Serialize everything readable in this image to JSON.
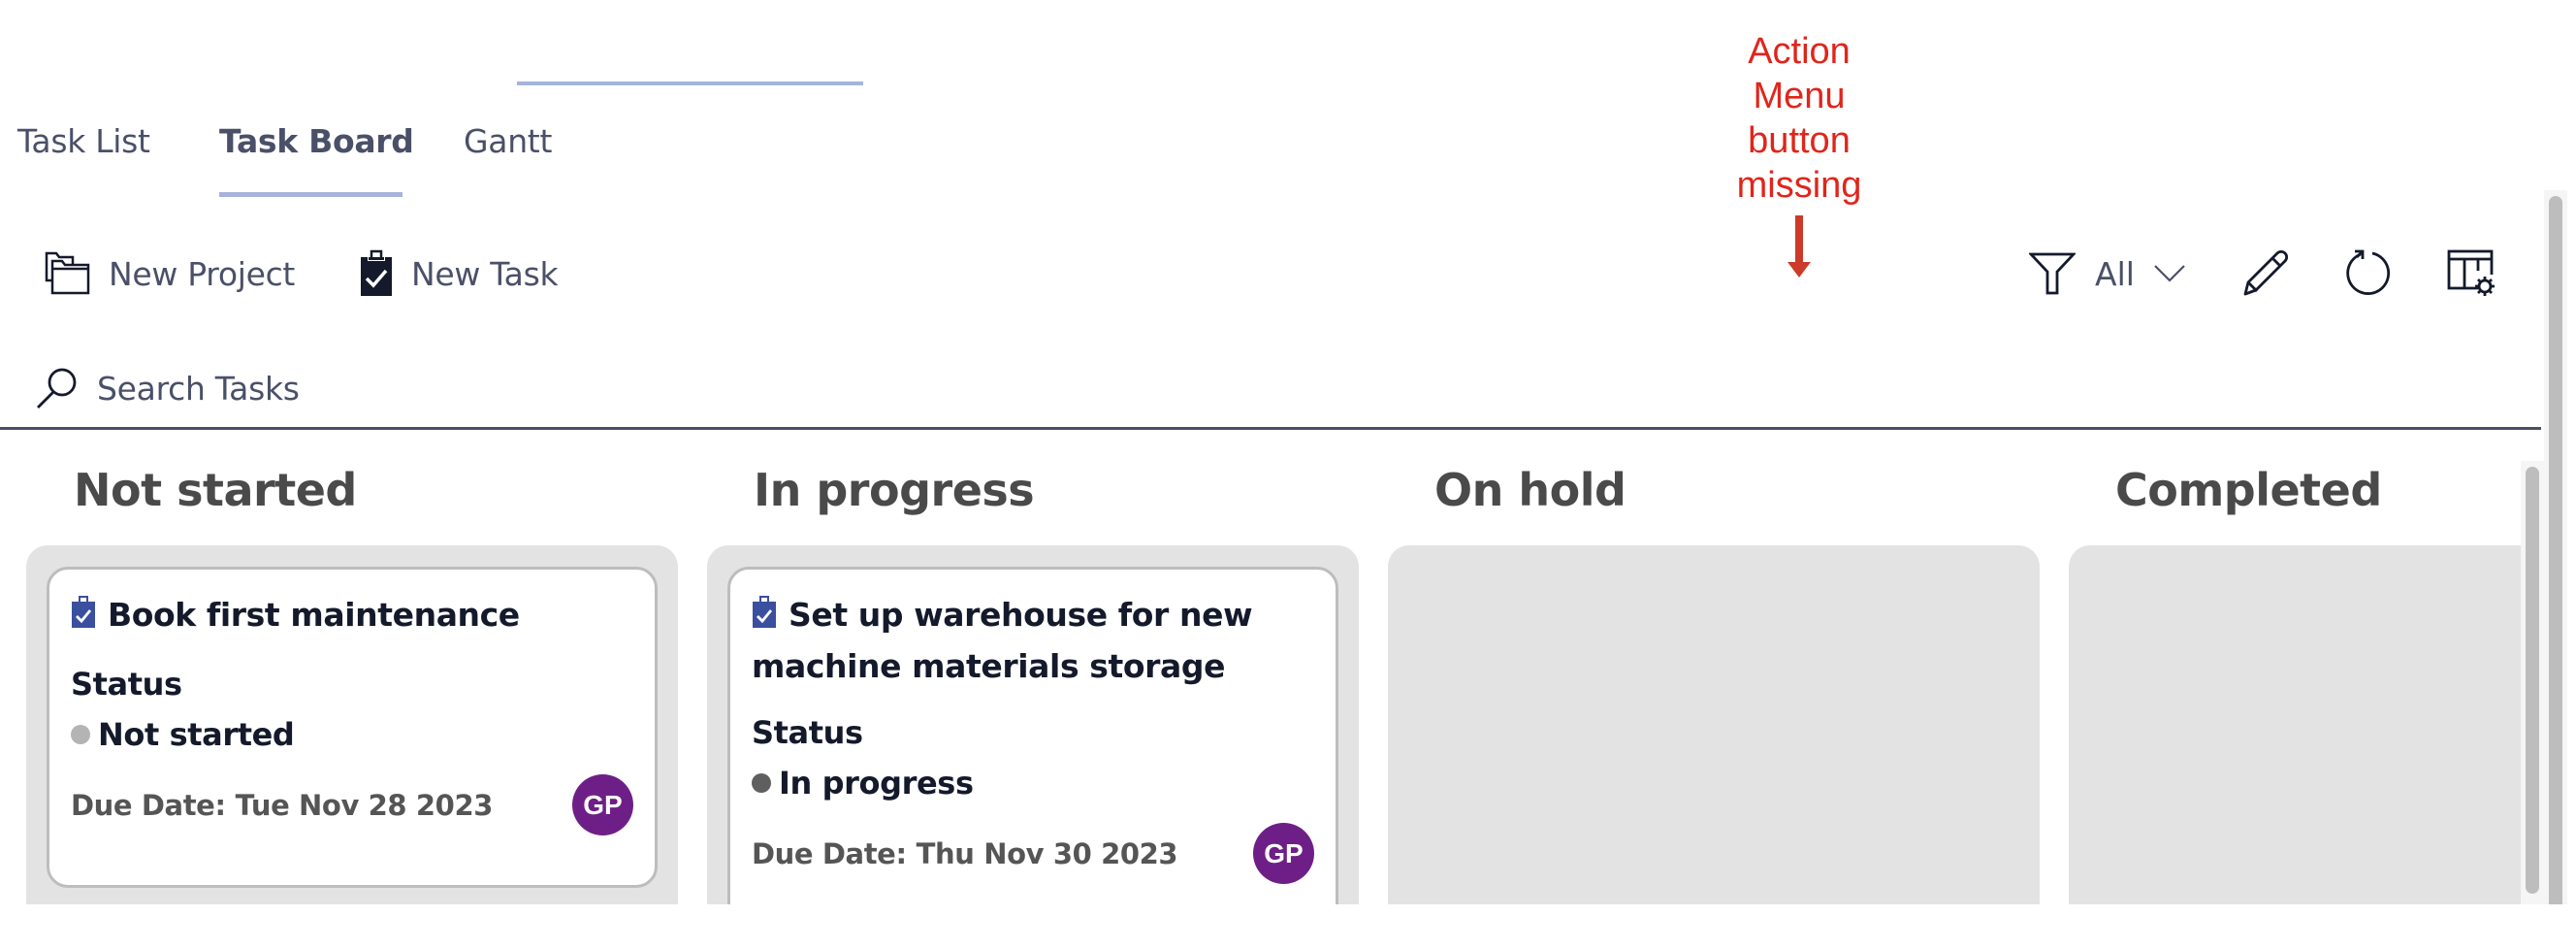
{
  "tabs": [
    {
      "label": "Task List",
      "active": false
    },
    {
      "label": "Task Board",
      "active": true
    },
    {
      "label": "Gantt",
      "active": false
    }
  ],
  "toolbar": {
    "new_project_label": "New Project",
    "new_task_label": "New Task",
    "filter_value": "All",
    "icons": {
      "new_project": "folders-icon",
      "new_task": "clipboard-check-icon",
      "filter": "funnel-icon",
      "filter_dropdown": "chevron-down-icon",
      "edit": "pencil-icon",
      "refresh": "refresh-icon",
      "board_settings": "table-settings-icon"
    }
  },
  "search": {
    "placeholder": "Search Tasks",
    "value": "",
    "icon": "search-icon"
  },
  "annotation": {
    "text_lines": [
      "Action",
      "Menu",
      "button",
      "missing"
    ],
    "color": "#e0251b",
    "arrow_color": "#cc3a2a"
  },
  "board": {
    "columns": [
      {
        "title": "Not started",
        "cards": [
          {
            "title": "Book first maintenance",
            "status_label": "Status",
            "status": "Not started",
            "status_color": "#b4b4b4",
            "due_label": "Due Date:",
            "due_date": "Tue Nov 28 2023",
            "assignee_initials": "GP"
          }
        ]
      },
      {
        "title": "In progress",
        "cards": [
          {
            "title": "Set up warehouse for new machine materials storage",
            "status_label": "Status",
            "status": "In progress",
            "status_color": "#5f5f5f",
            "due_label": "Due Date:",
            "due_date": "Thu Nov 30 2023",
            "assignee_initials": "GP"
          }
        ]
      },
      {
        "title": "On hold",
        "cards": []
      },
      {
        "title": "Completed",
        "cards": []
      }
    ]
  },
  "colors": {
    "accent": "#a6b3dc",
    "text": "#4a5068",
    "column_bg": "#e3e3e3",
    "avatar_bg": "#6e1f87",
    "task_icon": "#3a4f9e"
  }
}
